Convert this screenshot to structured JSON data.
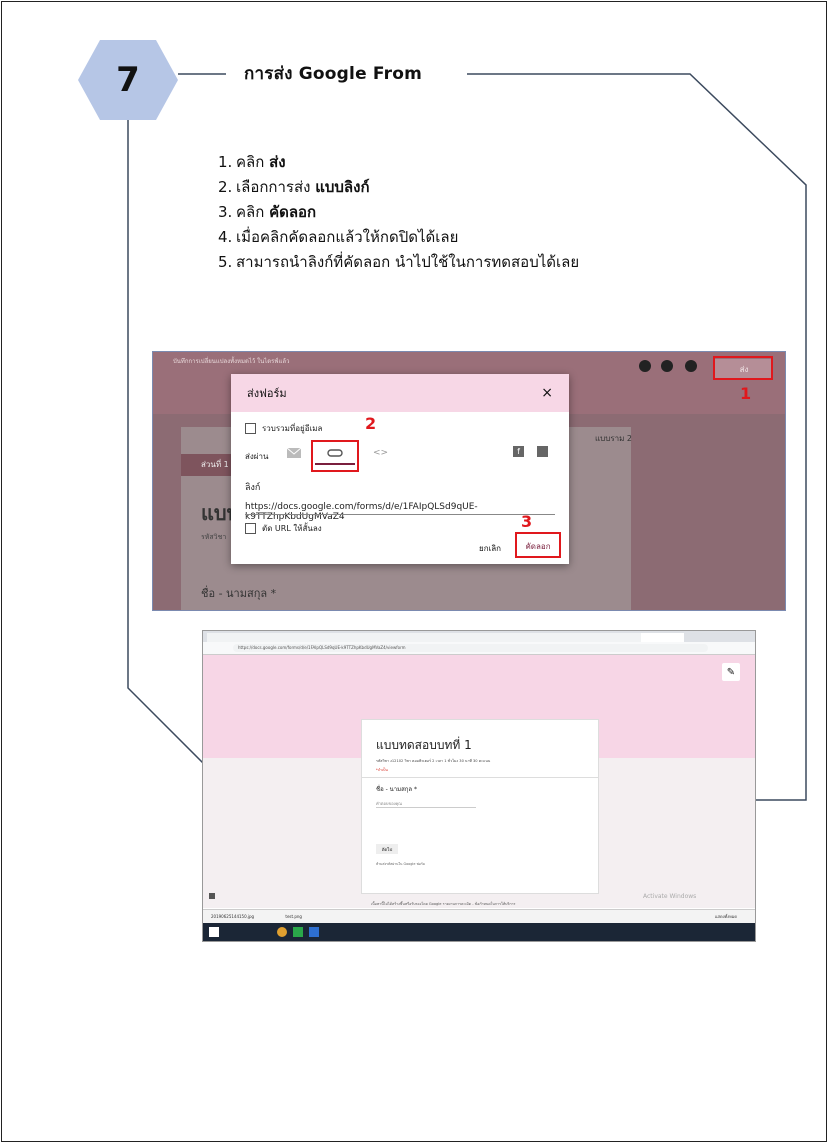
{
  "header": {
    "step_number": "7",
    "title": "การส่ง Google From"
  },
  "steps": [
    {
      "num": "1.",
      "text": "คลิก ",
      "bold": "ส่ง",
      "after": ""
    },
    {
      "num": "2.",
      "text": "เลือกการส่ง ",
      "bold": "แบบลิงก์",
      "after": ""
    },
    {
      "num": "3.",
      "text": "คลิก ",
      "bold": "คัดลอก",
      "after": ""
    },
    {
      "num": "4.",
      "text": "เมื่อคลิกคัดลอกแล้วให้กดปิดได้เลย",
      "bold": "",
      "after": ""
    },
    {
      "num": "5.",
      "text": "สามารถนำลิงก์ที่คัดลอก นำไปใช้ในการทดสอบได้เลย",
      "bold": "",
      "after": ""
    }
  ],
  "screenshot1": {
    "header_text": "บันทึกการเปลี่ยนแปลงทั้งหมดไว้ ในไดรฟ์แล้ว",
    "send_button": "ส่ง",
    "marker1": "1",
    "marker2": "2",
    "marker3": "3",
    "section_tab": "ส่วนที่ 1",
    "background_title": "แบบ",
    "background_sub": "รหัสวิชา",
    "background_field": "ชื่อ - นามสกุล *",
    "background_responses": "แบบราม 2",
    "dialog": {
      "title": "ส่งฟอร์ม",
      "close": "×",
      "collect_email": "รวบรวมที่อยู่อีเมล",
      "send_via": "ส่งผ่าน",
      "link_label": "ลิงก์",
      "link_url": "https://docs.google.com/forms/d/e/1FAIpQLSd9qUE-k9TTZhpKbdUgMVaZ4",
      "shorten_url": "ตัด URL ให้สั้นลง",
      "cancel": "ยกเลิก",
      "copy": "คัดลอก"
    }
  },
  "screenshot2": {
    "url": "https://docs.google.com/forms/d/e/1FAIpQLSd9qUE-k9TTZhpKbdUgMVaZ4/viewform",
    "form_title": "แบบทดสอบบทที่ 1",
    "form_subtitle": "รหัสวิชา ง12102  วิชา คอมพิวเตอร์ 2  เวลา 1 ชั่วโมง 30 นาที  30  คะแนน",
    "required_note": "*จำเป็น",
    "name_label": "ชื่อ - นามสกุล *",
    "answer_placeholder": "คำตอบของคุณ",
    "next_button": "ถัดไป",
    "google_forms_note": "ห้ามส่งรหัสผ่านใน Google ฟอร์ม",
    "disclaimer": "เนื้อหานี้ไม่ได้สร้างขึ้นหรือรับรองโดย Google รายงานการละเมิด - ข้อกำหนดในการให้บริการ",
    "activate": "Activate Windows",
    "download1": "20190625144150.jpg",
    "download2": "test.png",
    "show_all": "แสดงทั้งหมด"
  }
}
